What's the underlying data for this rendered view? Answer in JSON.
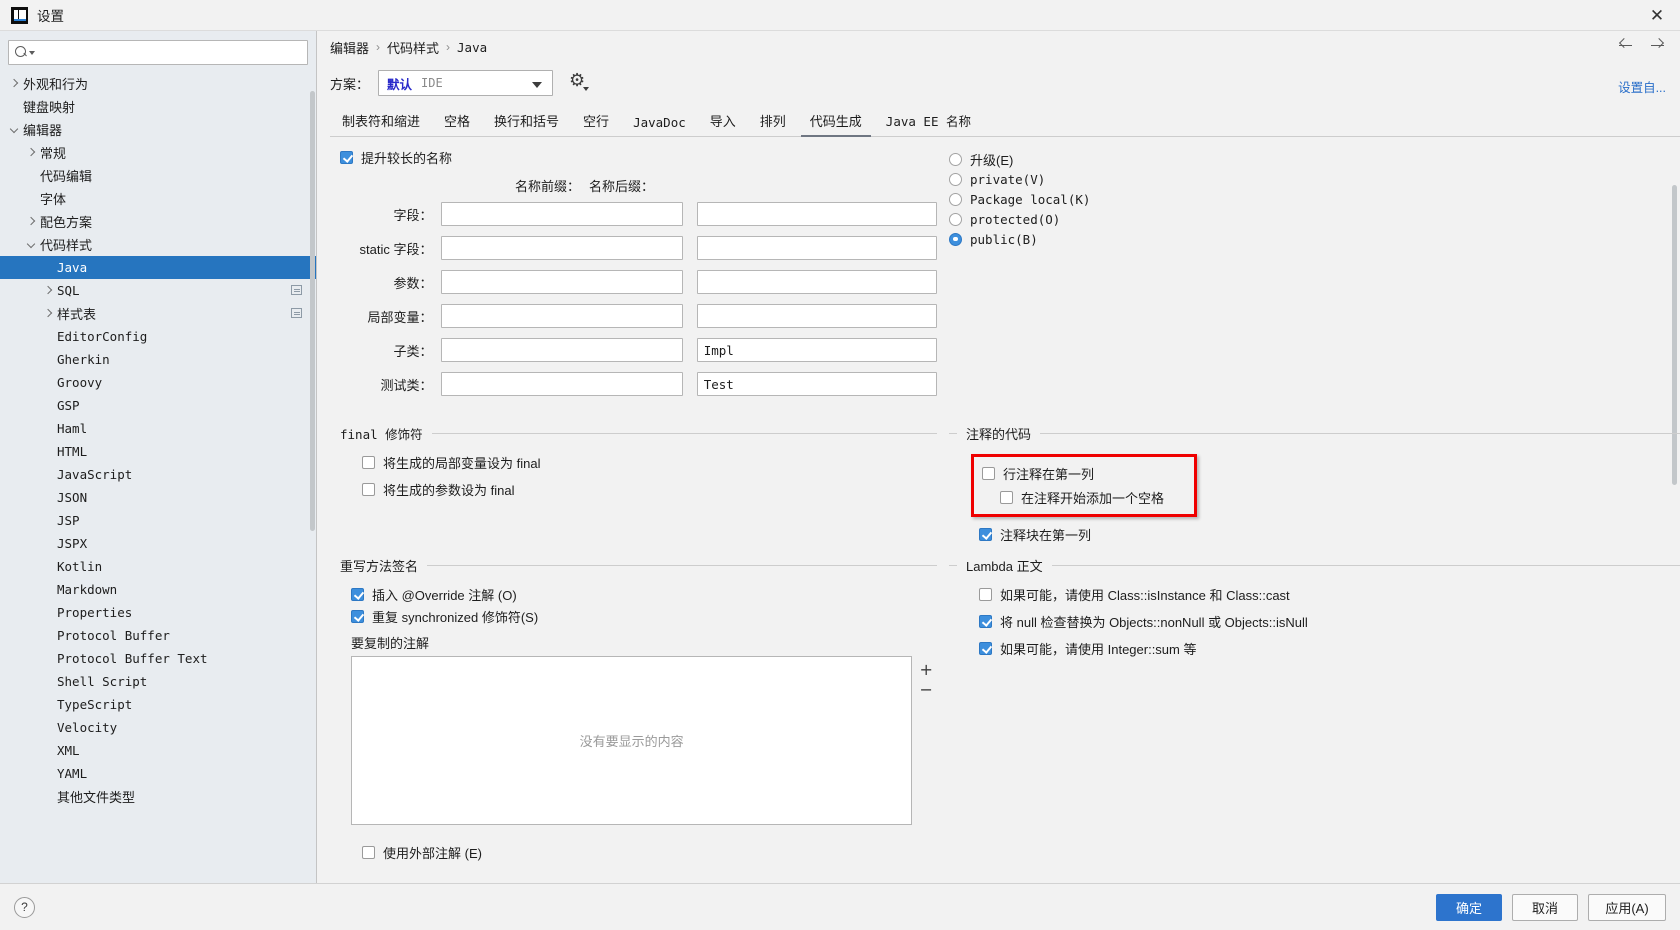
{
  "window": {
    "title": "设置",
    "close_icon": "close-icon"
  },
  "sidebar": {
    "search": {
      "value": "",
      "placeholder": ""
    },
    "items": [
      {
        "label": "外观和行为",
        "indent": 1,
        "twisty": "right",
        "mono": false,
        "selected": false
      },
      {
        "label": "键盘映射",
        "indent": 1,
        "twisty": "none",
        "mono": false,
        "selected": false
      },
      {
        "label": "编辑器",
        "indent": 1,
        "twisty": "down",
        "mono": false,
        "selected": false
      },
      {
        "label": "常规",
        "indent": 2,
        "twisty": "right",
        "mono": false,
        "selected": false
      },
      {
        "label": "代码编辑",
        "indent": 2,
        "twisty": "none",
        "mono": false,
        "selected": false
      },
      {
        "label": "字体",
        "indent": 2,
        "twisty": "none",
        "mono": false,
        "selected": false
      },
      {
        "label": "配色方案",
        "indent": 2,
        "twisty": "right",
        "mono": false,
        "selected": false
      },
      {
        "label": "代码样式",
        "indent": 2,
        "twisty": "down",
        "mono": false,
        "selected": false
      },
      {
        "label": "Java",
        "indent": 3,
        "twisty": "none",
        "mono": true,
        "selected": true
      },
      {
        "label": "SQL",
        "indent": 3,
        "twisty": "right",
        "mono": true,
        "selected": false,
        "badge": true
      },
      {
        "label": "样式表",
        "indent": 3,
        "twisty": "right",
        "mono": false,
        "selected": false,
        "badge": true
      },
      {
        "label": "EditorConfig",
        "indent": 3,
        "twisty": "none",
        "mono": true,
        "selected": false
      },
      {
        "label": "Gherkin",
        "indent": 3,
        "twisty": "none",
        "mono": true,
        "selected": false
      },
      {
        "label": "Groovy",
        "indent": 3,
        "twisty": "none",
        "mono": true,
        "selected": false
      },
      {
        "label": "GSP",
        "indent": 3,
        "twisty": "none",
        "mono": true,
        "selected": false
      },
      {
        "label": "Haml",
        "indent": 3,
        "twisty": "none",
        "mono": true,
        "selected": false
      },
      {
        "label": "HTML",
        "indent": 3,
        "twisty": "none",
        "mono": true,
        "selected": false
      },
      {
        "label": "JavaScript",
        "indent": 3,
        "twisty": "none",
        "mono": true,
        "selected": false
      },
      {
        "label": "JSON",
        "indent": 3,
        "twisty": "none",
        "mono": true,
        "selected": false
      },
      {
        "label": "JSP",
        "indent": 3,
        "twisty": "none",
        "mono": true,
        "selected": false
      },
      {
        "label": "JSPX",
        "indent": 3,
        "twisty": "none",
        "mono": true,
        "selected": false
      },
      {
        "label": "Kotlin",
        "indent": 3,
        "twisty": "none",
        "mono": true,
        "selected": false
      },
      {
        "label": "Markdown",
        "indent": 3,
        "twisty": "none",
        "mono": true,
        "selected": false
      },
      {
        "label": "Properties",
        "indent": 3,
        "twisty": "none",
        "mono": true,
        "selected": false
      },
      {
        "label": "Protocol Buffer",
        "indent": 3,
        "twisty": "none",
        "mono": true,
        "selected": false
      },
      {
        "label": "Protocol Buffer Text",
        "indent": 3,
        "twisty": "none",
        "mono": true,
        "selected": false
      },
      {
        "label": "Shell Script",
        "indent": 3,
        "twisty": "none",
        "mono": true,
        "selected": false
      },
      {
        "label": "TypeScript",
        "indent": 3,
        "twisty": "none",
        "mono": true,
        "selected": false
      },
      {
        "label": "Velocity",
        "indent": 3,
        "twisty": "none",
        "mono": true,
        "selected": false
      },
      {
        "label": "XML",
        "indent": 3,
        "twisty": "none",
        "mono": true,
        "selected": false
      },
      {
        "label": "YAML",
        "indent": 3,
        "twisty": "none",
        "mono": true,
        "selected": false
      },
      {
        "label": "其他文件类型",
        "indent": 3,
        "twisty": "none",
        "mono": false,
        "selected": false
      }
    ]
  },
  "breadcrumb": {
    "p1": "编辑器",
    "p2": "代码样式",
    "p3": "Java",
    "sep": "›"
  },
  "scheme": {
    "label": "方案：",
    "value_bold": "默认",
    "value_sub": "IDE",
    "gear_icon": "gear-icon",
    "settings_link": "设置自..."
  },
  "tabs": [
    {
      "label": "制表符和缩进",
      "mono": false,
      "active": false
    },
    {
      "label": "空格",
      "mono": false,
      "active": false
    },
    {
      "label": "换行和括号",
      "mono": false,
      "active": false
    },
    {
      "label": "空行",
      "mono": false,
      "active": false
    },
    {
      "label": "JavaDoc",
      "mono": true,
      "active": false
    },
    {
      "label": "导入",
      "mono": false,
      "active": false
    },
    {
      "label": "排列",
      "mono": false,
      "active": false
    },
    {
      "label": "代码生成",
      "mono": false,
      "active": true
    },
    {
      "label": "Java EE 名称",
      "mono": true,
      "active": false
    }
  ],
  "naming": {
    "prefer_longer": {
      "label": "提升较长的名称",
      "checked": true
    },
    "col_prefix": "名称前缀：",
    "col_suffix": "名称后缀：",
    "rows": [
      {
        "label": "字段：",
        "prefix": "",
        "suffix": ""
      },
      {
        "label": "static 字段：",
        "prefix": "",
        "suffix": ""
      },
      {
        "label": "参数：",
        "prefix": "",
        "suffix": ""
      },
      {
        "label": "局部变量：",
        "prefix": "",
        "suffix": ""
      },
      {
        "label": "子类：",
        "prefix": "",
        "suffix": "Impl"
      },
      {
        "label": "测试类：",
        "prefix": "",
        "suffix": "Test"
      }
    ]
  },
  "visibility": {
    "options": [
      {
        "label": "升级(E)",
        "mono": false,
        "selected": false
      },
      {
        "label": "private(V)",
        "mono": true,
        "selected": false
      },
      {
        "label": "Package local(K)",
        "mono": true,
        "selected": false
      },
      {
        "label": "protected(O)",
        "mono": true,
        "selected": false
      },
      {
        "label": "public(B)",
        "mono": true,
        "selected": true
      }
    ]
  },
  "final_modifier": {
    "title": "final 修饰符",
    "items": [
      {
        "label": "将生成的局部变量设为 final",
        "checked": false
      },
      {
        "label": "将生成的参数设为 final",
        "checked": false
      }
    ]
  },
  "commented_code": {
    "title": "注释的代码",
    "items": [
      {
        "label": "行注释在第一列",
        "checked": false,
        "indent": 0,
        "highlight": true
      },
      {
        "label": "在注释开始添加一个空格",
        "checked": false,
        "indent": 1,
        "highlight": true
      },
      {
        "label": "注释块在第一列",
        "checked": true,
        "indent": 0,
        "highlight": false
      }
    ]
  },
  "override_signature": {
    "title": "重写方法签名",
    "items": [
      {
        "label": "插入 @Override 注解 (O)",
        "checked": true
      },
      {
        "label": "重复 synchronized 修饰符(S)",
        "checked": true
      }
    ],
    "annotations_label": "要复制的注解",
    "empty_text": "没有要显示的内容",
    "add_icon": "plus-icon",
    "remove_icon": "minus-icon"
  },
  "lambda": {
    "title": "Lambda 正文",
    "items": [
      {
        "label": "如果可能，请使用 Class::isInstance 和 Class::cast",
        "checked": false
      },
      {
        "label": "将 null 检查替换为 Objects::nonNull 或 Objects::isNull",
        "checked": true
      },
      {
        "label": "如果可能，请使用 Integer::sum 等",
        "checked": true
      }
    ]
  },
  "external_annotations": {
    "label": "使用外部注解 (E)",
    "checked": false
  },
  "footer": {
    "help_icon": "question-icon",
    "ok": "确定",
    "cancel": "取消",
    "apply": "应用(A)"
  },
  "colors": {
    "accent": "#2675bf",
    "primary_button": "#2d74cd",
    "highlight_box": "#ef0000",
    "link": "#2a6fc9",
    "scheme_value": "#2a2aca"
  }
}
